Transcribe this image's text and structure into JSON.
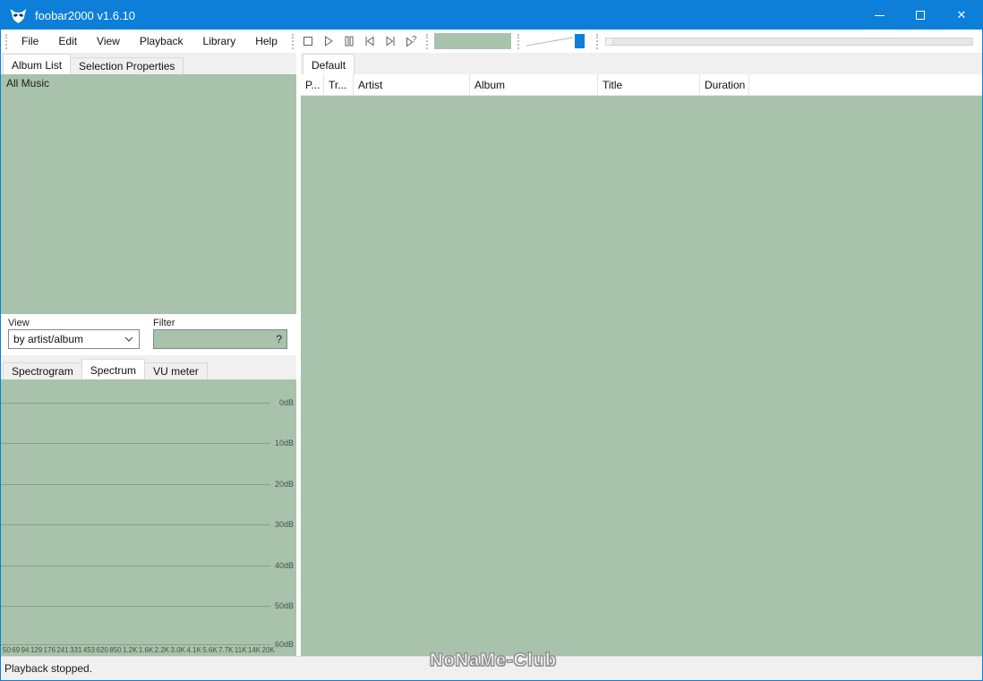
{
  "window": {
    "title": "foobar2000 v1.6.10",
    "controls": {
      "close": "✕"
    }
  },
  "menu": {
    "items": [
      "File",
      "Edit",
      "View",
      "Playback",
      "Library",
      "Help"
    ]
  },
  "toolbar": {
    "buttons": [
      "stop",
      "play",
      "pause",
      "previous",
      "next",
      "random"
    ],
    "random_mark": "?"
  },
  "left_panel": {
    "tabs": [
      {
        "label": "Album List",
        "active": true
      },
      {
        "label": "Selection Properties",
        "active": false
      }
    ],
    "tree_root": "All Music",
    "view_label": "View",
    "view_value": "by artist/album",
    "filter_label": "Filter",
    "filter_value": "?",
    "viz_tabs": [
      {
        "label": "Spectrogram",
        "active": false
      },
      {
        "label": "Spectrum",
        "active": true
      },
      {
        "label": "VU meter",
        "active": false
      }
    ],
    "spectrum": {
      "db_labels": [
        "0dB",
        "10dB",
        "20dB",
        "30dB",
        "40dB",
        "50dB",
        "60dB"
      ],
      "freq_labels": [
        "50",
        "69",
        "94",
        "129",
        "176",
        "241",
        "331",
        "453",
        "620",
        "850",
        "1.2K",
        "1.6K",
        "2.2K",
        "3.0K",
        "4.1K",
        "5.6K",
        "7.7K",
        "11K",
        "14K",
        "20K"
      ]
    }
  },
  "playlist": {
    "tab_label": "Default",
    "columns": [
      "P...",
      "Tr...",
      "Artist",
      "Album",
      "Title",
      "Duration"
    ],
    "rows": []
  },
  "statusbar": {
    "text": "Playback stopped."
  },
  "watermark": {
    "text": "NoNaMe-Club"
  },
  "colors": {
    "titlebar_blue": "#0d7fd9",
    "panel_green": "#a8c2ac"
  }
}
